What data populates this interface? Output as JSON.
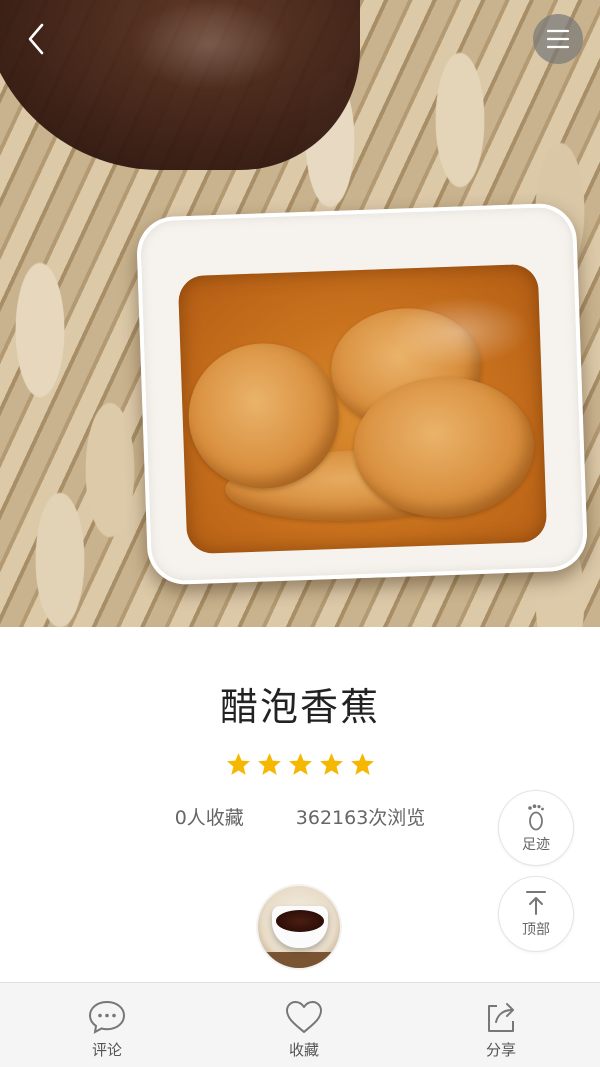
{
  "recipe": {
    "title": "醋泡香蕉",
    "rating": 5,
    "rating_max": 5,
    "favorites_text": "0人收藏",
    "views_text": "362163次浏览"
  },
  "side_actions": {
    "footprint_label": "足迹",
    "top_label": "顶部"
  },
  "bottom_bar": {
    "comment_label": "评论",
    "favorite_label": "收藏",
    "share_label": "分享"
  },
  "icons": {
    "back": "chevron-left-icon",
    "menu": "hamburger-menu-icon",
    "star": "star-icon",
    "footprint": "footprint-icon",
    "top": "arrow-up-to-top-icon",
    "comment": "speech-bubble-icon",
    "favorite": "heart-icon",
    "share": "share-icon"
  },
  "colors": {
    "star": "#f6b700",
    "accent_text": "#222222",
    "bar_background": "#f5f5f5"
  }
}
